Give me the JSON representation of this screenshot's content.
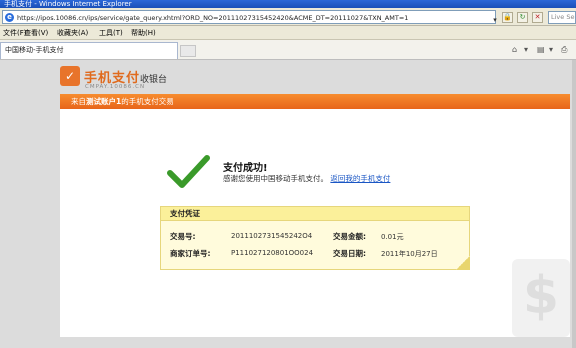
{
  "window": {
    "title": "手机支付 - Windows Internet Explorer"
  },
  "address_bar": {
    "url": "https://ipos.10086.cn/ips/service/gate_query.xhtml?ORD_NO=20111027315452420&ACME_DT=20111027&TXN_AMT=1",
    "search_placeholder": "Live Se"
  },
  "menu": {
    "items": [
      "文件(F)",
      "查看(V)",
      "收藏夹(A)",
      "工具(T)",
      "帮助(H)"
    ]
  },
  "tabs": {
    "active_tab": "中国移动-手机支付"
  },
  "brand": {
    "logo_name": "手机支付",
    "logo_sub": "CMPAY.10086.CN",
    "cashier": "收银台"
  },
  "header_bar": {
    "prefix": "来自",
    "account": "测试账户1",
    "suffix": "的手机支付交易"
  },
  "result": {
    "title": "支付成功!",
    "message": "感谢您使用中国移动手机支付。",
    "return_link": "返回我的手机支付"
  },
  "voucher": {
    "title": "支付凭证",
    "trade_no_label": "交易号:",
    "trade_no": "2011102731545242O4",
    "amount_label": "交易金额:",
    "amount": "0.01元",
    "order_no_label": "商家订单号:",
    "order_no": "P111027120801OO024",
    "date_label": "交易日期:",
    "date": "2011年10月27日"
  },
  "colors": {
    "accent_orange": "#e8651a",
    "check_green": "#3a9a2a",
    "voucher_bg": "#fffbdc",
    "link_blue": "#1a56c4"
  }
}
